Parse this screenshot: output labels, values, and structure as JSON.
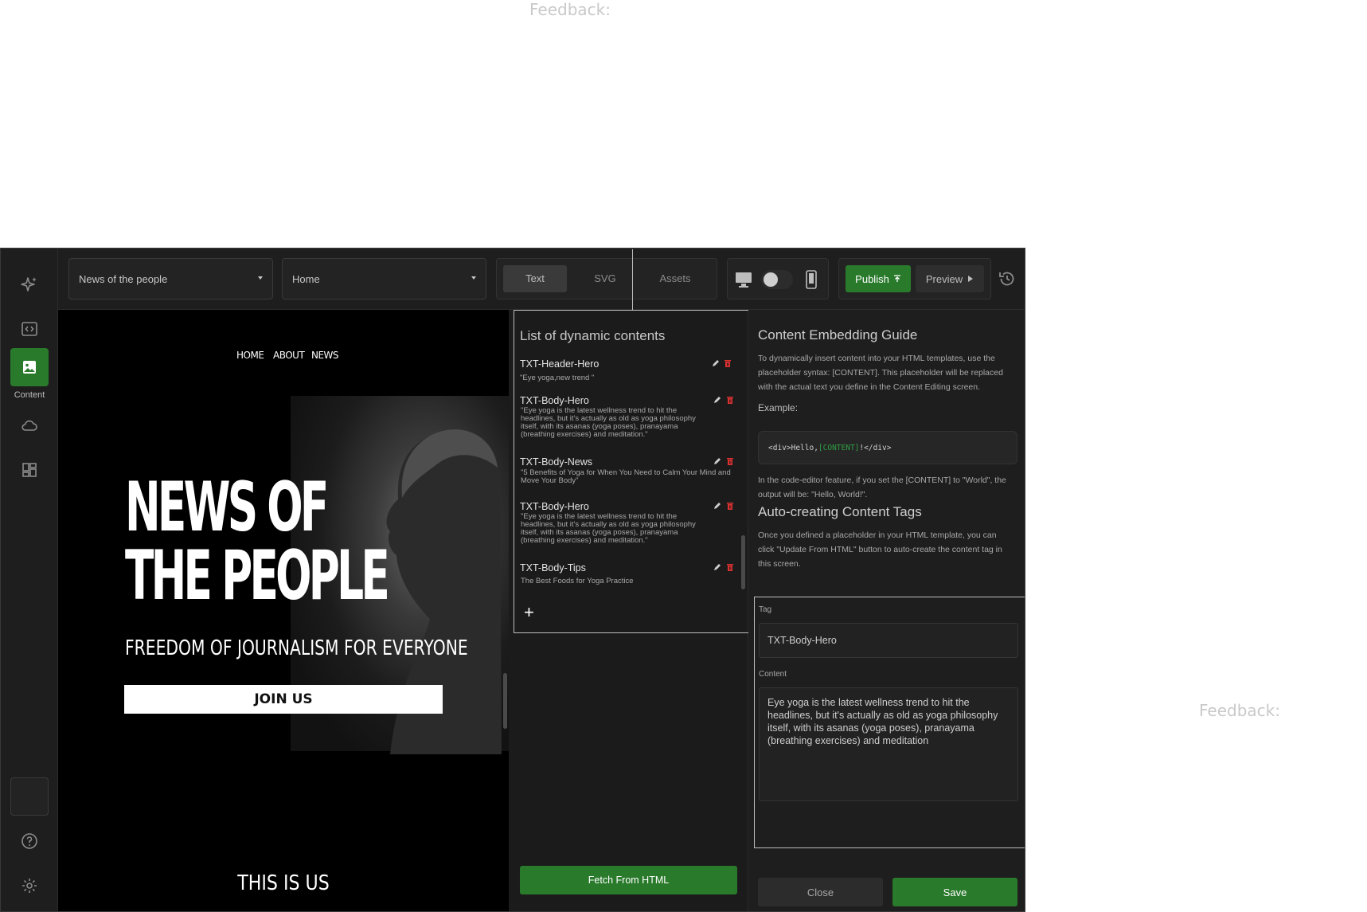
{
  "feedback_labels": [
    "Feedback:",
    "Feedback:"
  ],
  "sidebar": {
    "active_label": "Content"
  },
  "toolbar": {
    "site_select": "News of the people",
    "page_select": "Home",
    "tabs": [
      "Text",
      "SVG",
      "Assets"
    ],
    "publish": "Publish",
    "preview": "Preview"
  },
  "canvas": {
    "nav": [
      "HOME",
      "ABOUT",
      "NEWS"
    ],
    "title_line1": "NEWS OF",
    "title_line2": "THE PEOPLE",
    "subtitle": "FREEDOM OF JOURNALISM FOR EVERYONE",
    "cta": "JOIN US",
    "section_title": "THIS IS US"
  },
  "dynamic": {
    "title": "List of dynamic contents",
    "items": [
      {
        "name": "TXT-Header-Hero",
        "text": "\"Eye yoga,new trend \""
      },
      {
        "name": "TXT-Body-Hero",
        "text": "\"Eye yoga is the latest wellness trend to hit the headlines, but it's actually as old as yoga philosophy itself, with its asanas (yoga poses), pranayama (breathing exercises) and meditation.\""
      },
      {
        "name": "TXT-Body-News",
        "text": "\"5 Benefits of Yoga for When You Need to Calm Your Mind and Move Your Body\""
      },
      {
        "name": "TXT-Body-Hero",
        "text": "\"Eye yoga is the latest wellness trend to hit the headlines, but it's actually as old as yoga philosophy itself, with its asanas (yoga poses), pranayama (breathing exercises) and meditation.\""
      },
      {
        "name": "TXT-Body-Tips",
        "text": "The Best Foods for Yoga Practice"
      }
    ],
    "add": "+",
    "fetch": "Fetch From HTML"
  },
  "guide": {
    "title": "Content Embedding Guide",
    "intro": "To dynamically insert content into your HTML templates, use the placeholder syntax: [CONTENT]. This placeholder will be replaced with the actual text you define in the Content Editing screen.",
    "example_label": "Example:",
    "code_before": "<div>Hello, ",
    "code_tag": "[CONTENT]",
    "code_after": "!</div>",
    "example_note": "In the code-editor feature, if you set the [CONTENT] to \"World\", the output will be: \"Hello, World!\".",
    "auto_title": "Auto-creating Content Tags",
    "auto_text": "Once you defined a placeholder in your HTML template, you can click \"Update From HTML\" button to auto-create the content tag in this screen."
  },
  "form": {
    "tag_label": "Tag",
    "tag_value": "TXT-Body-Hero",
    "content_label": "Content",
    "content_value": "Eye yoga is the latest wellness trend to hit the headlines, but it's actually as old as yoga philosophy itself, with its asanas (yoga poses), pranayama (breathing exercises) and meditation",
    "close": "Close",
    "save": "Save"
  },
  "colors": {
    "accent": "#2a7a2c",
    "delete": "#e03131",
    "app_bg": "#1a1a1a"
  }
}
